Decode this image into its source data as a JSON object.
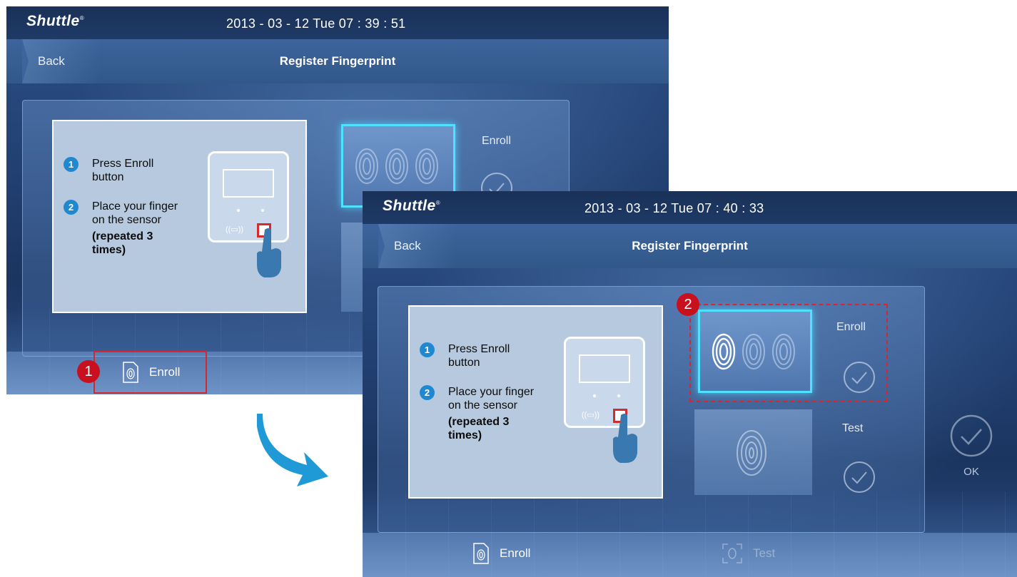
{
  "screen1": {
    "logo": "Shuttle",
    "logo_mark": "®",
    "datetime": "2013 - 03 - 12  Tue  07 : 39 : 51",
    "back_label": "Back",
    "title": "Register Fingerprint",
    "step1": "Press Enroll button",
    "step2": "Place your finger on the sensor",
    "step2_note": "(repeated 3 times)",
    "enroll_label": "Enroll",
    "enroll_button": "Enroll"
  },
  "screen2": {
    "logo": "Shuttle",
    "logo_mark": "®",
    "datetime": "2013 - 03 - 12  Tue  07 : 40 : 33",
    "back_label": "Back",
    "title": "Register Fingerprint",
    "step1": "Press Enroll button",
    "step2": "Place your finger on the sensor",
    "step2_note": "(repeated 3 times)",
    "enroll_label": "Enroll",
    "test_label": "Test",
    "ok_label": "OK",
    "enroll_button": "Enroll",
    "test_button": "Test",
    "enroll_progress": "1/3"
  },
  "annotations": {
    "callout1": "1",
    "callout2": "2",
    "highlight_color": "#d8262e",
    "arrow_color": "#1f9ad6"
  },
  "step_numbers": {
    "one": "1",
    "two": "2"
  }
}
